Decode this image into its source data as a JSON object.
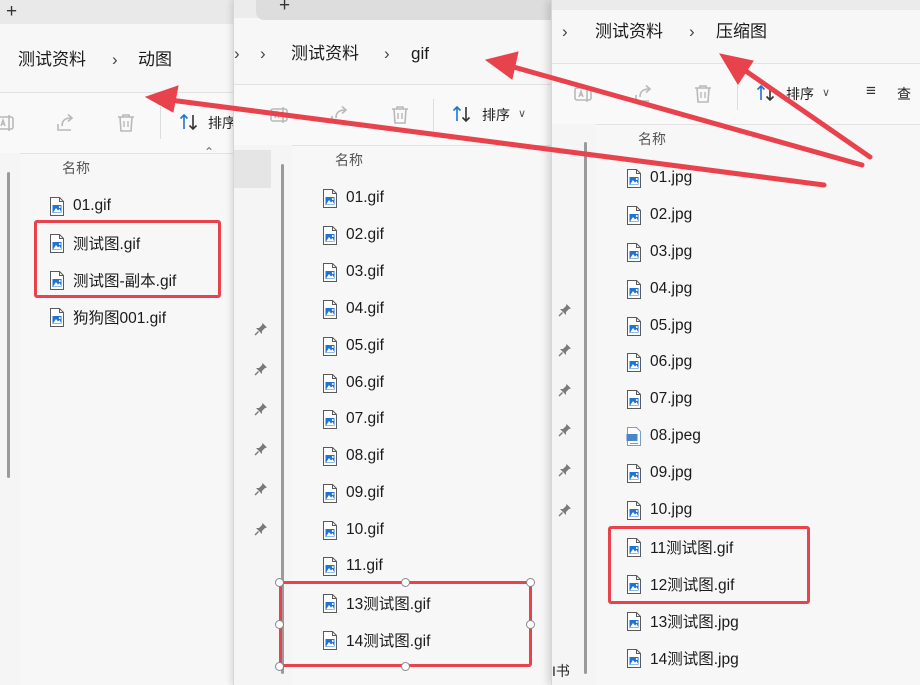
{
  "win1": {
    "breadcrumb": [
      "测试资料",
      "动图"
    ],
    "toolbar": {
      "sort_label": "排序"
    },
    "column_header": "名称",
    "files": [
      "01.gif",
      "测试图.gif",
      "测试图-副本.gif",
      "狗狗图001.gif"
    ]
  },
  "win2": {
    "breadcrumb": [
      "测试资料",
      "gif"
    ],
    "toolbar": {
      "sort_label": "排序"
    },
    "column_header": "名称",
    "files": [
      "01.gif",
      "02.gif",
      "03.gif",
      "04.gif",
      "05.gif",
      "06.gif",
      "07.gif",
      "08.gif",
      "09.gif",
      "10.gif",
      "11.gif",
      "13测试图.gif",
      "14测试图.gif"
    ]
  },
  "win3": {
    "breadcrumb": [
      "测试资料",
      "压缩图"
    ],
    "toolbar": {
      "sort_label": "排序",
      "view_label": "查"
    },
    "column_header": "名称",
    "nav_partial_text": "I书",
    "files": [
      "01.jpg",
      "02.jpg",
      "03.jpg",
      "04.jpg",
      "05.jpg",
      "06.jpg",
      "07.jpg",
      "08.jpeg",
      "09.jpg",
      "10.jpg",
      "11测试图.gif",
      "12测试图.gif",
      "13测试图.jpg",
      "14测试图.jpg"
    ]
  },
  "annotation": {
    "color": "#e8434d"
  },
  "icons": [
    "plus-icon",
    "chevron-right-icon",
    "rename-icon",
    "share-icon",
    "delete-icon",
    "sort-icon",
    "chevron-down-icon",
    "view-icon",
    "pin-icon",
    "image-file-icon"
  ]
}
